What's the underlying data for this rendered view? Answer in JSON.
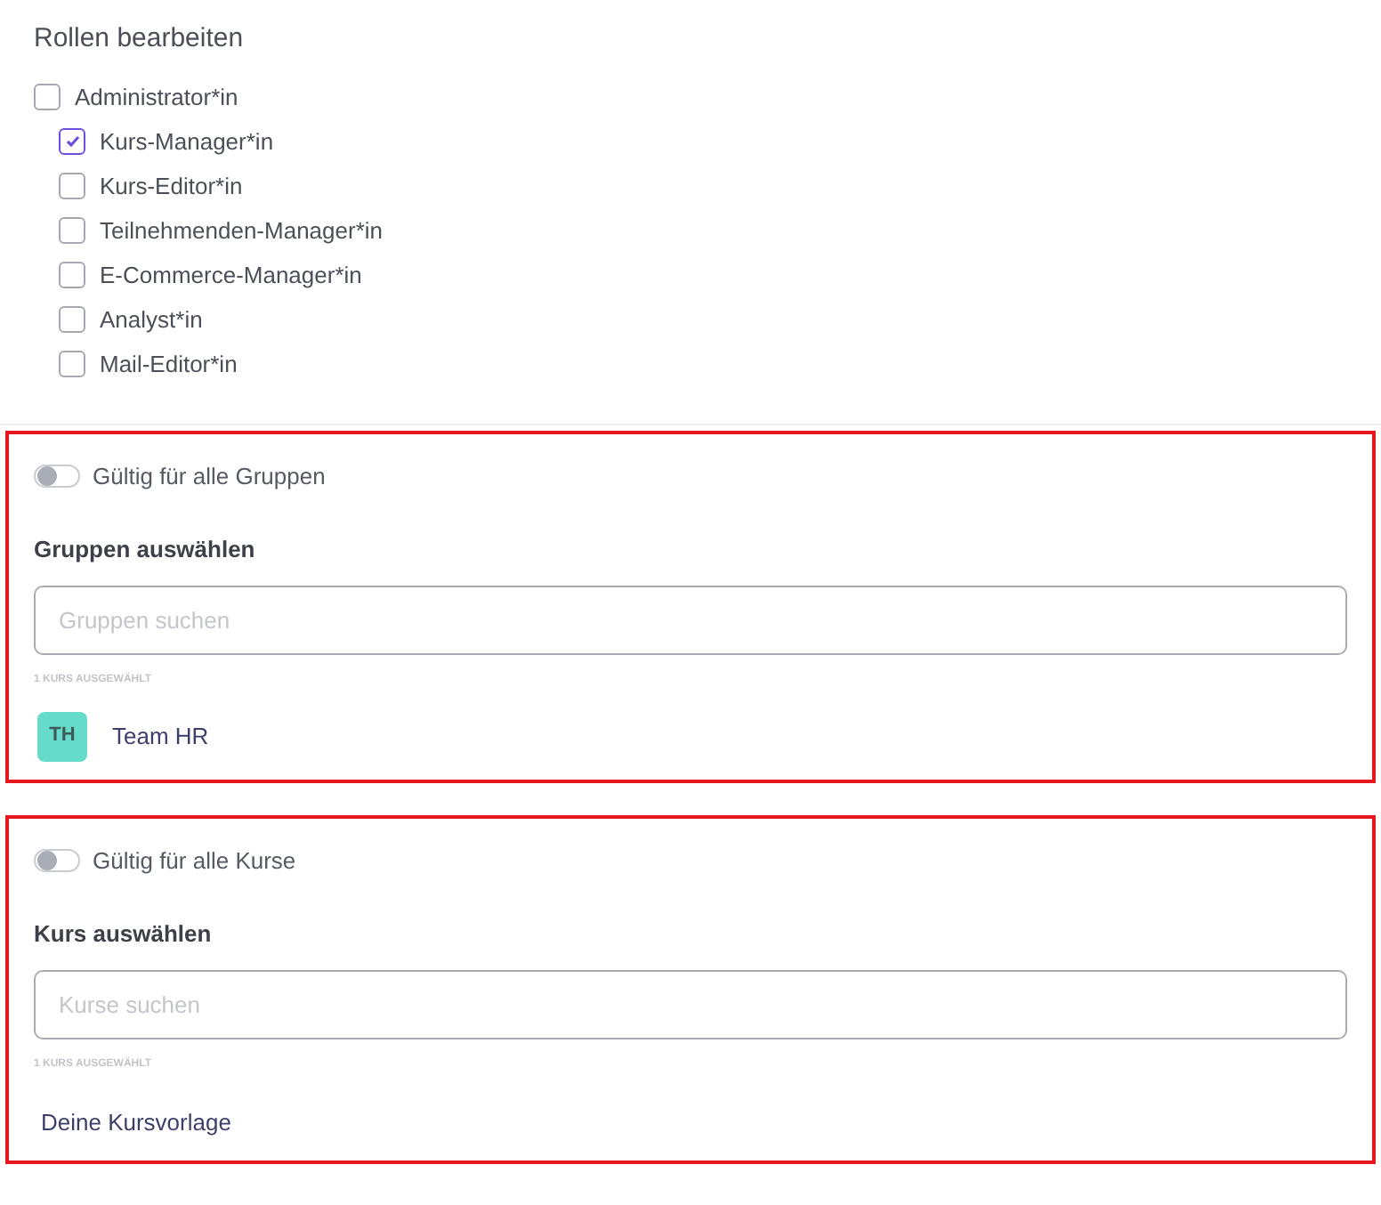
{
  "title": "Rollen bearbeiten",
  "roles": [
    {
      "label": "Administrator*in",
      "checked": false,
      "children": [
        {
          "label": "Kurs-Manager*in",
          "checked": true
        },
        {
          "label": "Kurs-Editor*in",
          "checked": false
        },
        {
          "label": "Teilnehmenden-Manager*in",
          "checked": false
        },
        {
          "label": "E-Commerce-Manager*in",
          "checked": false
        },
        {
          "label": "Analyst*in",
          "checked": false
        },
        {
          "label": "Mail-Editor*in",
          "checked": false
        }
      ]
    }
  ],
  "sections": [
    {
      "toggle": {
        "label": "Gültig für alle Gruppen",
        "on": false
      },
      "heading": "Gruppen auswählen",
      "search": {
        "placeholder": "Gruppen suchen"
      },
      "count": "1 KURS AUSGEWÄHLT",
      "items": [
        {
          "kind": "avatar",
          "initials": "TH",
          "name": "Team HR"
        }
      ]
    },
    {
      "toggle": {
        "label": "Gültig für alle Kurse",
        "on": false
      },
      "heading": "Kurs auswählen",
      "search": {
        "placeholder": "Kurse suchen"
      },
      "count": "1 KURS AUSGEWÄHLT",
      "items": [
        {
          "kind": "plain",
          "name": "Deine Kursvorlage"
        }
      ]
    }
  ]
}
